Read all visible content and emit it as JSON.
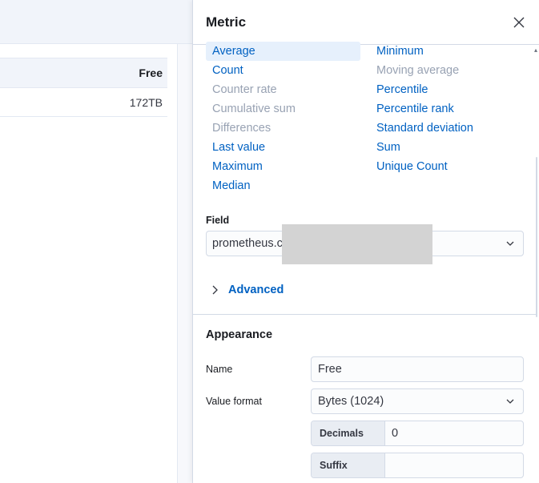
{
  "background": {
    "table": {
      "header": "Free",
      "rows": [
        "172TB"
      ]
    }
  },
  "flyout": {
    "title": "Metric",
    "functions_left": [
      {
        "label": "Average",
        "state": "selected"
      },
      {
        "label": "Count",
        "state": "enabled"
      },
      {
        "label": "Counter rate",
        "state": "disabled"
      },
      {
        "label": "Cumulative sum",
        "state": "disabled"
      },
      {
        "label": "Differences",
        "state": "disabled"
      },
      {
        "label": "Last value",
        "state": "enabled"
      },
      {
        "label": "Maximum",
        "state": "enabled"
      },
      {
        "label": "Median",
        "state": "enabled"
      }
    ],
    "functions_right": [
      {
        "label": "Minimum",
        "state": "enabled"
      },
      {
        "label": "Moving average",
        "state": "disabled"
      },
      {
        "label": "Percentile",
        "state": "enabled"
      },
      {
        "label": "Percentile rank",
        "state": "enabled"
      },
      {
        "label": "Standard deviation",
        "state": "enabled"
      },
      {
        "label": "Sum",
        "state": "enabled"
      },
      {
        "label": "Unique Count",
        "state": "enabled"
      }
    ],
    "field": {
      "label": "Field",
      "value": "prometheus.c"
    },
    "advanced_label": "Advanced",
    "appearance": {
      "title": "Appearance",
      "name_label": "Name",
      "name_value": "Free",
      "value_format_label": "Value format",
      "value_format_value": "Bytes (1024)",
      "decimals_label": "Decimals",
      "decimals_value": "0",
      "suffix_label": "Suffix",
      "suffix_value": ""
    }
  },
  "colors": {
    "link": "#0061c2",
    "disabled": "#98a2b3",
    "selected_bg": "#e6f0fc"
  }
}
